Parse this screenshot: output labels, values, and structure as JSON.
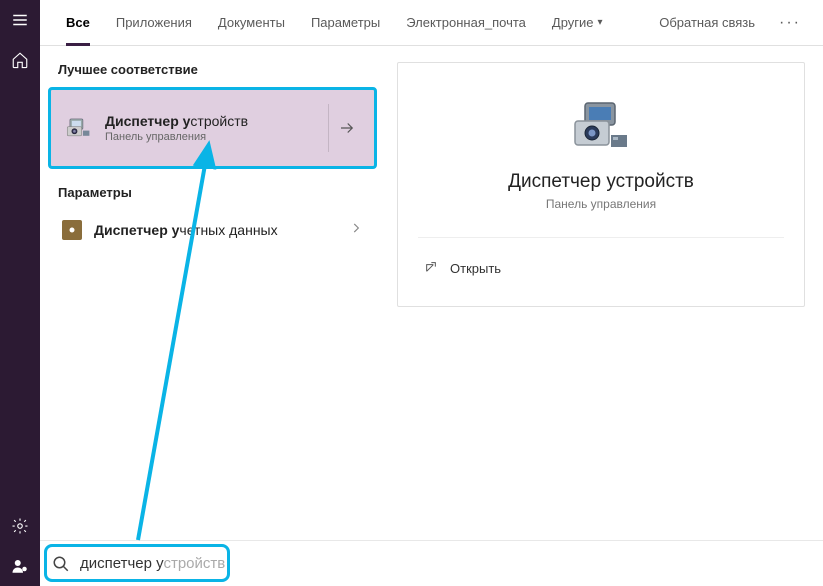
{
  "rail": {
    "items": [
      "menu",
      "home",
      "settings",
      "user"
    ]
  },
  "tabs": {
    "items": [
      {
        "label": "Все",
        "active": true,
        "dropdown": false
      },
      {
        "label": "Приложения",
        "active": false,
        "dropdown": false
      },
      {
        "label": "Документы",
        "active": false,
        "dropdown": false
      },
      {
        "label": "Параметры",
        "active": false,
        "dropdown": false
      },
      {
        "label": "Электронная_почта",
        "active": false,
        "dropdown": false
      },
      {
        "label": "Другие",
        "active": false,
        "dropdown": true
      }
    ],
    "feedback": "Обратная связь"
  },
  "results": {
    "best_label": "Лучшее соответствие",
    "best": {
      "title_prefix": "Диспетчер у",
      "title_rest": "стройств",
      "subtitle": "Панель управления"
    },
    "settings_label": "Параметры",
    "settings_item": {
      "title_prefix": "Диспетчер у",
      "title_rest": "четных данных"
    }
  },
  "detail": {
    "title": "Диспетчер устройств",
    "subtitle": "Панель управления",
    "open_label": "Открыть"
  },
  "search": {
    "typed": "диспетчер у",
    "suggest": "стройств"
  },
  "colors": {
    "accent": "#0ab4e6",
    "rail_bg": "#2c1a33"
  }
}
